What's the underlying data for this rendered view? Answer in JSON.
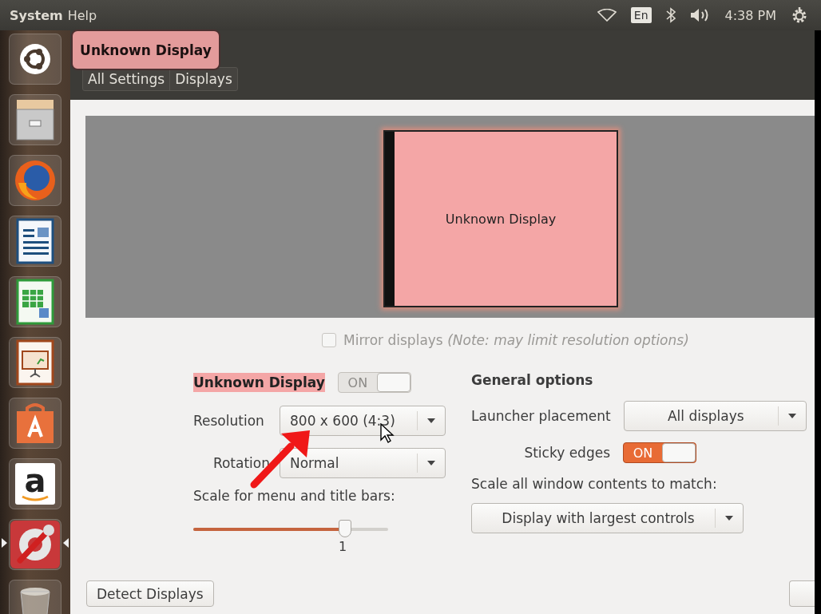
{
  "top_panel": {
    "menus": [
      "System",
      "Help"
    ],
    "keyboard_layout": "En",
    "clock": "4:38 PM"
  },
  "launcher": [
    {
      "kind": "ubuntu",
      "active": false
    },
    {
      "kind": "files",
      "active": false
    },
    {
      "kind": "browser",
      "active": false
    },
    {
      "kind": "writer",
      "active": false
    },
    {
      "kind": "calc",
      "active": false
    },
    {
      "kind": "impress",
      "active": false
    },
    {
      "kind": "software",
      "active": false
    },
    {
      "kind": "amazon",
      "label": "a",
      "active": false
    },
    {
      "kind": "settings",
      "active": true
    },
    {
      "kind": "trash",
      "active": false
    }
  ],
  "tooltip": {
    "text": "Unknown Display"
  },
  "breadcrumb": [
    "All Settings",
    "Displays"
  ],
  "preview": {
    "monitor_label": "Unknown Display"
  },
  "mirror": {
    "text": "Mirror displays *(Note: may limit resolution options)*",
    "checked": false,
    "disabled": true
  },
  "display": {
    "name": "Unknown Display",
    "switch": {
      "label": "ON",
      "on": true,
      "disabled": true
    },
    "resolution": {
      "label": "Resolution",
      "value": "800 x 600 (4:3)"
    },
    "rotation": {
      "label": "Rotation",
      "value": "Normal"
    },
    "scale": {
      "label": "Scale for menu and title bars:",
      "level": 0.78,
      "value": "1"
    }
  },
  "general": {
    "title": "General options",
    "launcher_placement": {
      "label": "Launcher placement",
      "value": "All displays"
    },
    "sticky_edges": {
      "label": "Sticky edges",
      "switch": {
        "label": "ON",
        "on": true,
        "disabled": false
      }
    },
    "scale_contents": {
      "label": "Scale all window contents to match:",
      "value": "Display with largest controls"
    }
  },
  "buttons": [
    "Detect Displays"
  ]
}
